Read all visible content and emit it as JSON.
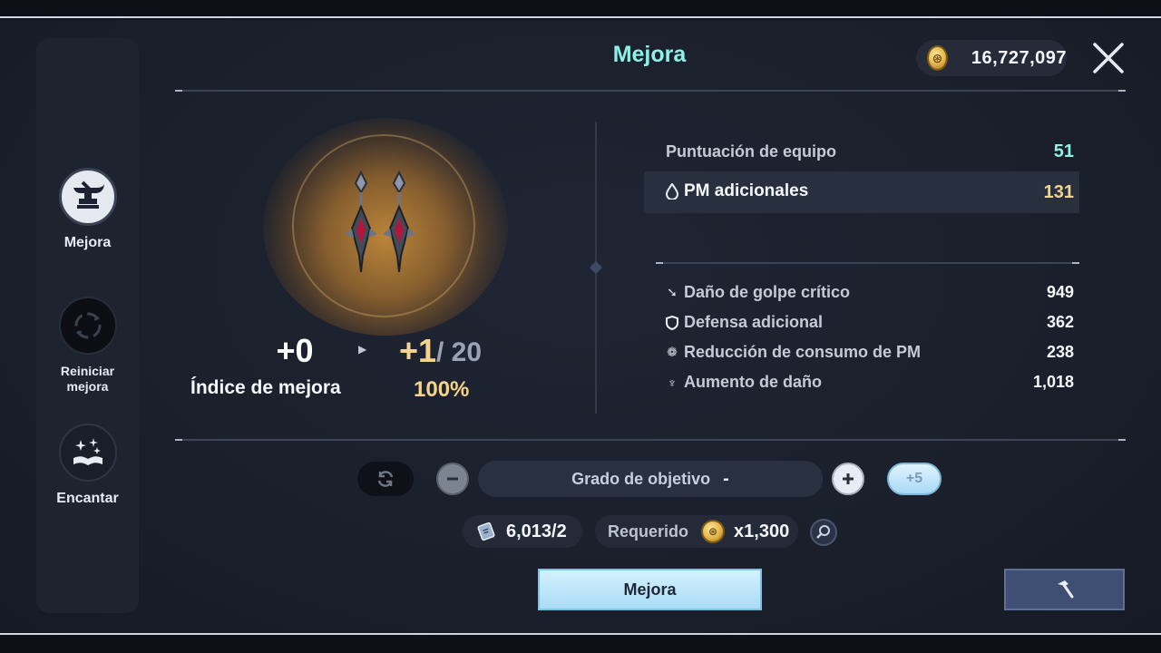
{
  "header": {
    "title": "Mejora",
    "gold": "16,727,097"
  },
  "sidebar": {
    "items": [
      {
        "label": "Mejora",
        "icon": "anvil-icon",
        "active": true
      },
      {
        "label_line1": "Reiniciar",
        "label_line2": "mejora",
        "icon": "reset-icon"
      },
      {
        "label": "Encantar",
        "icon": "enchant-book-icon"
      }
    ]
  },
  "item": {
    "current_level": "+0",
    "next_level": "+1",
    "max_level": "/ 20",
    "rate_label": "Índice de mejora",
    "rate_value": "100%"
  },
  "stats": {
    "score_label": "Puntuación de equipo",
    "score_value": "51",
    "main_label": "PM adicionales",
    "main_value": "131",
    "sub": [
      {
        "label": "Daño de golpe crítico",
        "value": "949",
        "icon": "critical-icon"
      },
      {
        "label": "Defensa adicional",
        "value": "362",
        "icon": "shield-icon"
      },
      {
        "label": "Reducción de consumo de PM",
        "value": "238",
        "icon": "mana-reduction-icon"
      },
      {
        "label": "Aumento de daño",
        "value": "1,018",
        "icon": "damage-icon"
      }
    ]
  },
  "controls": {
    "grade_label": "Grado de objetivo",
    "grade_value": "-",
    "plus5_label": "+5",
    "scroll_count": "6,013/2",
    "required_label": "Requerido",
    "required_value": "x1,300",
    "upgrade_label": "Mejora"
  },
  "colors": {
    "title": "#8ff0e8",
    "highlight": "#f3d48a",
    "score": "#8ff0e8",
    "button": "#aadcf5"
  }
}
